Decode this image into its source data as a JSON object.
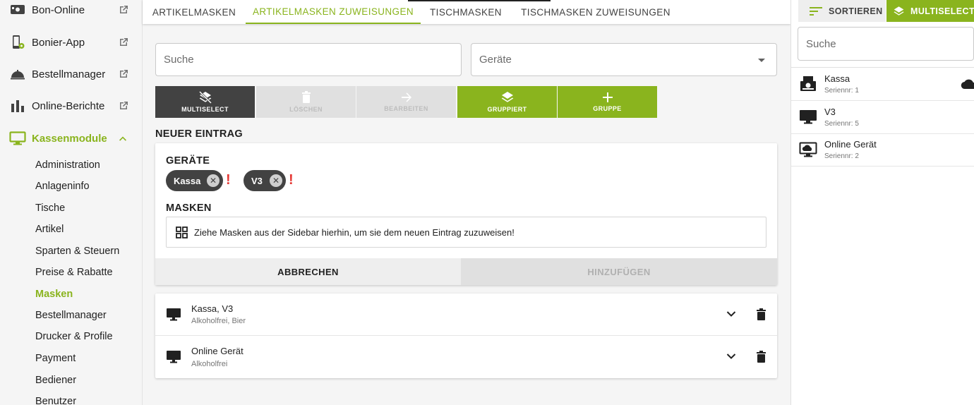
{
  "sidebar": {
    "nav": [
      {
        "label": "Bon-Online",
        "icon": "display-icon",
        "external": true
      },
      {
        "label": "Bonier-App",
        "icon": "phone-gear-icon",
        "external": true
      },
      {
        "label": "Bestellmanager",
        "icon": "cloche-icon",
        "external": true
      },
      {
        "label": "Online-Berichte",
        "icon": "bar-chart-icon",
        "external": true
      },
      {
        "label": "Kassenmodule",
        "icon": "monitor-icon",
        "expanded": true
      }
    ],
    "sub": [
      "Administration",
      "Anlageninfo",
      "Tische",
      "Artikel",
      "Sparten & Steuern",
      "Preise & Rabatte",
      "Masken",
      "Bestellmanager",
      "Drucker & Profile",
      "Payment",
      "Bediener",
      "Benutzer"
    ],
    "active_sub": "Masken"
  },
  "tabs": [
    "ARTIKELMASKEN",
    "ARTIKELMASKEN ZUWEISUNGEN",
    "TISCHMASKEN",
    "TISCHMASKEN ZUWEISUNGEN"
  ],
  "active_tab": "ARTIKELMASKEN ZUWEISUNGEN",
  "filters": {
    "search_placeholder": "Suche",
    "devices_label": "Geräte"
  },
  "toolbar": {
    "multiselect": "MULTISELECT",
    "delete": "LÖSCHEN",
    "edit": "BEARBEITEN",
    "grouped": "GRUPPIERT",
    "group": "GRUPPE"
  },
  "new_entry": {
    "title": "NEUER EINTRAG",
    "devices_title": "GERÄTE",
    "chips": [
      "Kassa",
      "V3"
    ],
    "masks_title": "MASKEN",
    "drop_hint": "Ziehe Masken aus der Sidebar hierhin, um sie dem neuen Eintrag zuzuweisen!",
    "cancel": "ABBRECHEN",
    "add": "HINZUFÜGEN"
  },
  "entries": [
    {
      "title": "Kassa, V3",
      "sub": "Alkoholfrei, Bier"
    },
    {
      "title": "Online Gerät",
      "sub": "Alkoholfrei"
    }
  ],
  "right_panel": {
    "sort": "SORTIEREN",
    "multiselect": "MULTISELECT",
    "search_placeholder": "Suche",
    "devices": [
      {
        "name": "Kassa",
        "serial": "Seriennr: 1"
      },
      {
        "name": "V3",
        "serial": "Seriennr: 5"
      },
      {
        "name": "Online Gerät",
        "serial": "Seriennr: 2"
      }
    ]
  },
  "colors": {
    "accent": "#8ab41e",
    "dark": "#424242",
    "warning": "#e53935"
  }
}
